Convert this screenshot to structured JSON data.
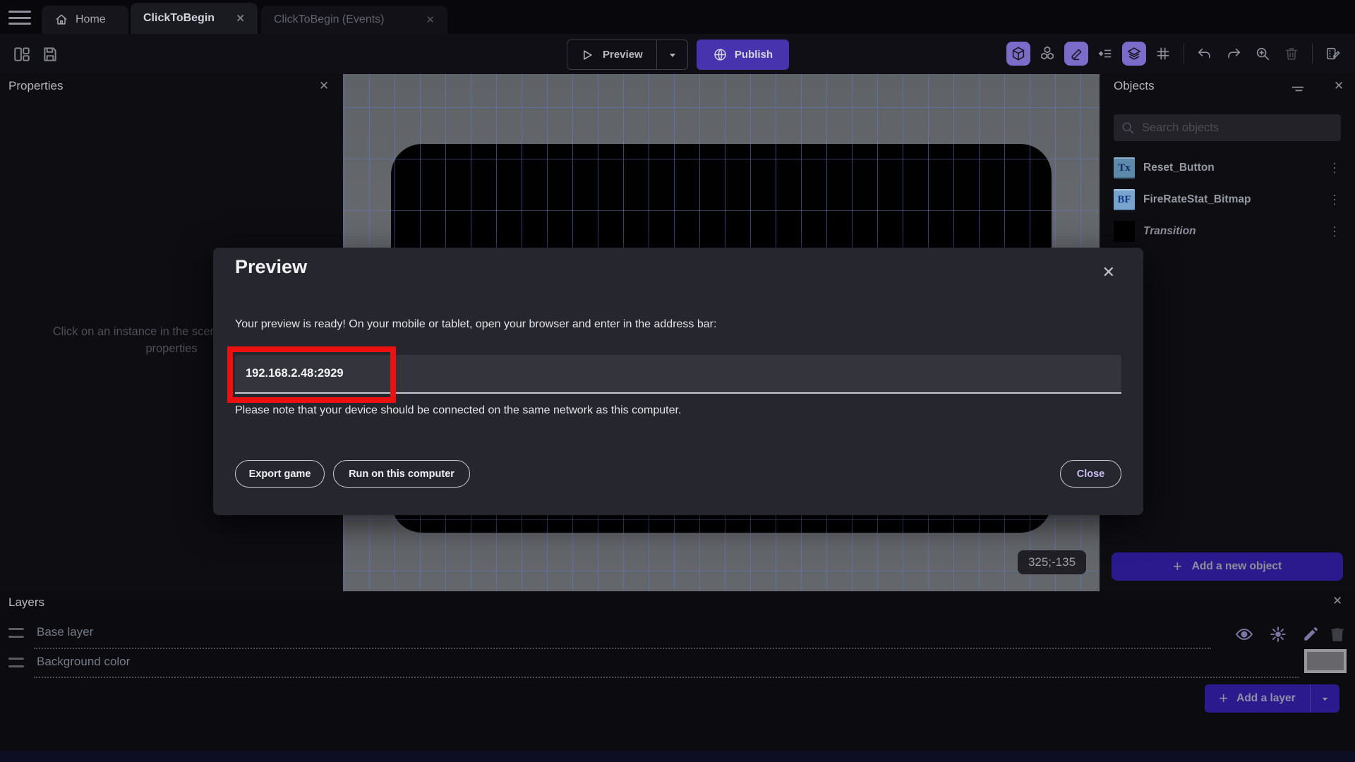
{
  "tabs": {
    "home_label": "Home",
    "scene_tab_label": "ClickToBegin",
    "events_tab_label": "ClickToBegin (Events)"
  },
  "toolbar": {
    "preview_label": "Preview",
    "publish_label": "Publish"
  },
  "properties_panel": {
    "title": "Properties",
    "empty_message": "Click on an instance in the scene to display its properties"
  },
  "canvas": {
    "coordinates_badge": "325;-135"
  },
  "objects_panel": {
    "title": "Objects",
    "search_placeholder": "Search objects",
    "items": [
      {
        "name": "Reset_Button",
        "thumb": "Tx"
      },
      {
        "name": "FireRateStat_Bitmap",
        "thumb": "BF"
      },
      {
        "name": "Transition",
        "thumb": ""
      }
    ],
    "add_object_label": "Add a new object"
  },
  "layers_panel": {
    "title": "Layers",
    "rows": [
      {
        "name": "Base layer"
      },
      {
        "name": "Background color"
      }
    ],
    "add_layer_label": "Add a layer"
  },
  "preview_dialog": {
    "title": "Preview",
    "message": "Your preview is ready! On your mobile or tablet, open your browser and enter in the address bar:",
    "address": "192.168.2.48:2929",
    "note": "Please note that your device should be connected on the same network as this computer.",
    "export_label": "Export game",
    "run_label": "Run on this computer",
    "close_label": "Close"
  },
  "colors": {
    "publish_accent": "#4733ae",
    "toolbar_highlight": "#7b6cc9",
    "add_button_purple": "#2a1a8e",
    "annotation_red": "#eb1111",
    "canvas_grey": "#63666b"
  }
}
